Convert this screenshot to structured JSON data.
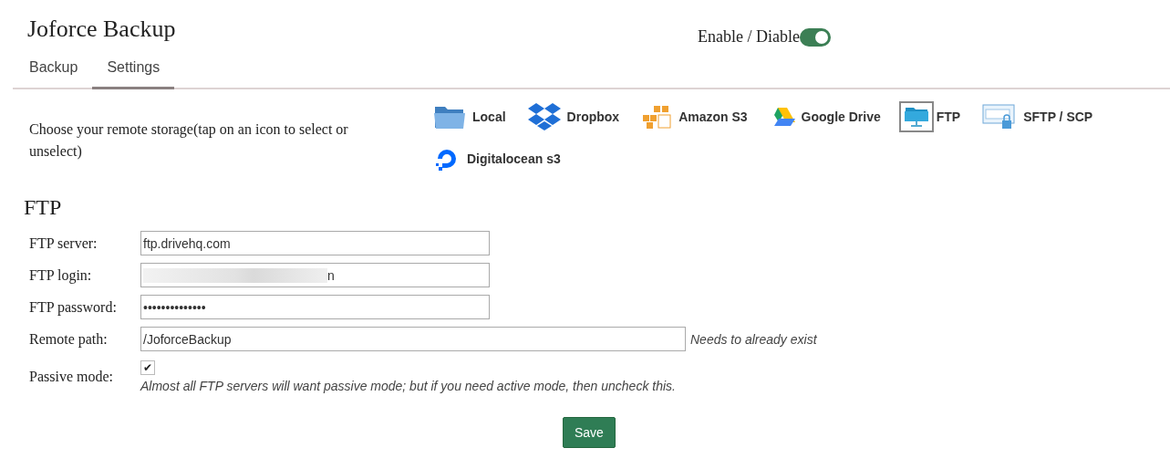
{
  "title": "Joforce Backup",
  "tabs": [
    {
      "label": "Backup",
      "selected": false
    },
    {
      "label": "Settings",
      "selected": true
    }
  ],
  "enable_toggle": {
    "label": "Enable / Diable",
    "on": true
  },
  "storage": {
    "prompt": "Choose your remote storage(tap on an icon to select or unselect)",
    "options": [
      {
        "kind": "local",
        "label": "Local",
        "selected": false
      },
      {
        "kind": "dropbox",
        "label": "Dropbox",
        "selected": false
      },
      {
        "kind": "s3",
        "label": "Amazon S3",
        "selected": false
      },
      {
        "kind": "gdrive",
        "label": "Google Drive",
        "selected": false
      },
      {
        "kind": "ftp",
        "label": "FTP",
        "selected": true
      },
      {
        "kind": "sftp",
        "label": "SFTP / SCP",
        "selected": false
      },
      {
        "kind": "digitalocean",
        "label": "Digitalocean s3",
        "selected": false
      }
    ]
  },
  "form": {
    "heading": "FTP",
    "fields": [
      {
        "kind": "text",
        "label": "FTP server:",
        "value": "ftp.drivehq.com",
        "wide": false
      },
      {
        "kind": "redacted",
        "label": "FTP login:",
        "value": "n",
        "wide": false
      },
      {
        "kind": "text",
        "label": "FTP password:",
        "value": "••••••••••••••",
        "wide": false
      },
      {
        "kind": "text",
        "label": "Remote path:",
        "value": "/JoforceBackup",
        "wide": true,
        "hint": "Needs to already exist"
      }
    ],
    "passive": {
      "label": "Passive mode:",
      "checked": true,
      "check_glyph": "✔",
      "hint": "Almost all FTP servers will want passive mode; but if you need active mode, then uncheck this."
    },
    "save": "Save"
  }
}
